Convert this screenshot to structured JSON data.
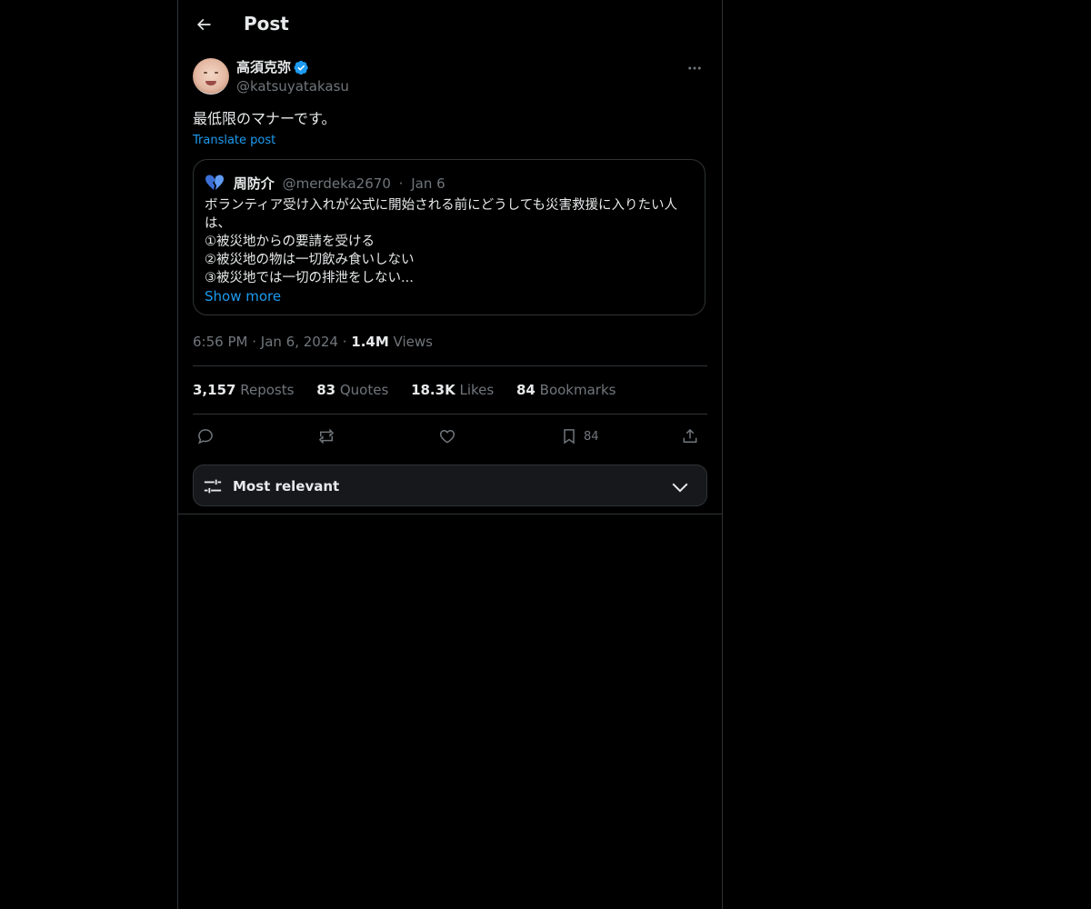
{
  "header": {
    "title": "Post"
  },
  "post": {
    "author_name": "高須克弥",
    "author_handle": "@katsuyatakasu",
    "text": "最低限のマナーです。",
    "translate_label": "Translate post",
    "time": "6:56 PM",
    "date": "Jan 6, 2024",
    "views_count": "1.4M",
    "views_label": "Views"
  },
  "quote": {
    "author_name": "周防介",
    "author_handle": "@merdeka2670",
    "date": "Jan 6",
    "lines": [
      "ボランティア受け入れが公式に開始される前にどうしても災害救援に入りたい人",
      "は、",
      "①被災地からの要請を受ける",
      "②被災地の物は一切飲み食いしない",
      "③被災地では一切の排泄をしない..."
    ],
    "show_more": "Show more"
  },
  "stats": {
    "reposts_count": "3,157",
    "reposts_label": "Reposts",
    "quotes_count": "83",
    "quotes_label": "Quotes",
    "likes_count": "18.3K",
    "likes_label": "Likes",
    "bookmarks_count": "84",
    "bookmarks_label": "Bookmarks"
  },
  "actions": {
    "bookmark_count": "84",
    "icons": [
      "reply-icon",
      "repost-icon",
      "like-icon",
      "bookmark-icon",
      "share-icon"
    ]
  },
  "sort": {
    "label": "Most relevant"
  },
  "colors": {
    "background": "#000000",
    "text": "#e7e9ea",
    "muted": "#71767b",
    "accent": "#1d9bf0",
    "border": "#2f3336"
  }
}
